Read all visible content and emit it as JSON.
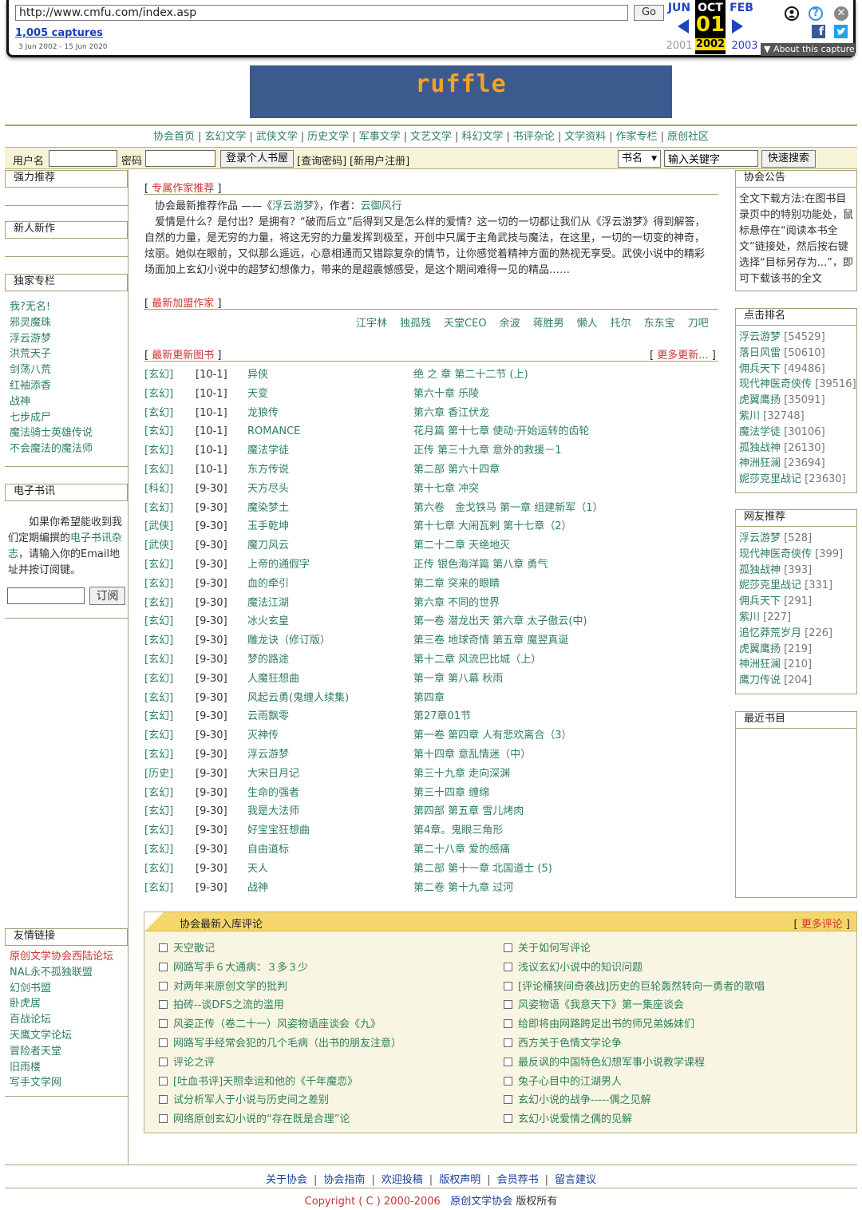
{
  "wayback": {
    "url": "http://www.cmfu.com/index.asp",
    "go_label": "Go",
    "captures": "1,005 captures",
    "range": "3 Jun 2002 - 15 Jun 2020",
    "prev_month": "JUN",
    "cur_month": "OCT",
    "next_month": "FEB",
    "cur_day": "01",
    "prev_year": "2001",
    "cur_year": "2002",
    "next_year": "2003",
    "about": "About this capture"
  },
  "banner": {
    "text": "ruffle"
  },
  "nav": [
    "协会首页",
    "玄幻文学",
    "武侠文学",
    "历史文学",
    "军事文学",
    "文艺文学",
    "科幻文学",
    "书评杂论",
    "文学资料",
    "作家专栏",
    "原创社区"
  ],
  "login": {
    "user_label": "用户名",
    "pass_label": "密码",
    "login_button": "登录个人书屋",
    "query_pass": "[查询密码]",
    "register": "[新用户注册]",
    "search_select": "书名",
    "search_placeholder": "输入关键字",
    "search_button": "快速搜索"
  },
  "left": {
    "strong_title": "强力推荐",
    "new_title": "新人新作",
    "exclusive_title": "独家专栏",
    "exclusive_items": [
      "我?无名!",
      "邪灵魔珠",
      "浮云游梦",
      "洪荒天子",
      "剑荡八荒",
      "红袖添香",
      "战神",
      "七步成尸",
      "魔法骑士英雄传说",
      "不会魔法的魔法师"
    ],
    "ebook_title": "电子书讯",
    "ebook_text_1": "如果你希望能收到我们定期编撰的",
    "ebook_link": "电子书讯杂志",
    "ebook_text_2": "，请输入你的Email地址并按订阅键。",
    "subscribe_button": "订阅",
    "friends_title": "友情链接",
    "friends": [
      "原创文学协会西陆论坛",
      "NAL永不孤独联盟",
      "幻剑书盟",
      "卧虎居",
      "百战论坛",
      "天鹰文学论坛",
      "冒险者天堂",
      "旧雨楼",
      "写手文学网"
    ]
  },
  "main": {
    "feature_title": "专属作家推荐",
    "feature_intro_1": "协会最新推荐作品 ——《",
    "feature_book": "浮云游梦",
    "feature_intro_2": "》，作者：",
    "feature_author": "云御风行",
    "feature_body": "爱情是什么？是付出？是拥有？“破而后立”后得到又是怎么样的爱情？这一切的一切都让我们从《浮云游梦》得到解答，自然的力量，是无穷的力量，将这无穷的力量发挥到极至，开创中只属于主角武技与魔法，在这里，一切的一切变的神奇，炫丽。她似在眼前，又似那么遥远，心意相通而又错踪复杂的情节，让你感觉着精神方面的熟视无享受。武侠小说中的精彩场面加上玄幻小说中的超梦幻想像力，带来的是超震憾感受，是这个期间难得一见的精品……",
    "new_authors_title": "最新加盟作家",
    "new_authors": [
      "江宇林",
      "独孤残",
      "天堂CEO",
      "余波",
      "蒋胜男",
      "懒人",
      "托尔",
      "东东宝",
      "刀吧",
      "冰"
    ],
    "updates_title": "最新更新图书",
    "more_updates": "更多更新...",
    "books": [
      {
        "cat": "[玄幻]",
        "date": "[10-1]",
        "name": "异侠",
        "chapter": "绝 之 章 第二十二节 (上)"
      },
      {
        "cat": "[玄幻]",
        "date": "[10-1]",
        "name": "天变",
        "chapter": "第六十章 乐陵"
      },
      {
        "cat": "[玄幻]",
        "date": "[10-1]",
        "name": "龙狼传",
        "chapter": "第六章 香江伏龙"
      },
      {
        "cat": "[玄幻]",
        "date": "[10-1]",
        "name": "ROMANCE",
        "chapter": "花月篇 第十七章 使动·开始运转的齿轮"
      },
      {
        "cat": "[玄幻]",
        "date": "[10-1]",
        "name": "魔法学徒",
        "chapter": "正传 第三十九章 意外的救援－1"
      },
      {
        "cat": "[玄幻]",
        "date": "[10-1]",
        "name": "东方传说",
        "chapter": "第二部 第六十四章"
      },
      {
        "cat": "[科幻]",
        "date": "[9-30]",
        "name": "天方尽头",
        "chapter": "第十七章 冲突"
      },
      {
        "cat": "[玄幻]",
        "date": "[9-30]",
        "name": "魔染梦土",
        "chapter": "第六卷　金戈铁马 第一章 组建新军（1）"
      },
      {
        "cat": "[武侠]",
        "date": "[9-30]",
        "name": "玉手乾坤",
        "chapter": "第十七章 大闹瓦剌 第十七章（2）"
      },
      {
        "cat": "[武侠]",
        "date": "[9-30]",
        "name": "魔刀风云",
        "chapter": "第二十二章 天绝地灭"
      },
      {
        "cat": "[玄幻]",
        "date": "[9-30]",
        "name": "上帝的通假字",
        "chapter": "正传 银色海洋篇 第八章 勇气"
      },
      {
        "cat": "[玄幻]",
        "date": "[9-30]",
        "name": "血的牵引",
        "chapter": "第二章 突来的眼睛"
      },
      {
        "cat": "[玄幻]",
        "date": "[9-30]",
        "name": "魔法江湖",
        "chapter": "第六章 不同的世界"
      },
      {
        "cat": "[玄幻]",
        "date": "[9-30]",
        "name": "冰火玄皇",
        "chapter": "第一卷 潜龙出天 第六章 太子傲云(中)"
      },
      {
        "cat": "[玄幻]",
        "date": "[9-30]",
        "name": "雕龙诀（修订版）",
        "chapter": "第三卷 地球奇情 第五章 魔翌真诞"
      },
      {
        "cat": "[玄幻]",
        "date": "[9-30]",
        "name": "梦的路途",
        "chapter": "第十二章 风流巴比城（上）"
      },
      {
        "cat": "[玄幻]",
        "date": "[9-30]",
        "name": "人魔狂想曲",
        "chapter": "第一章 第八幕 秋雨"
      },
      {
        "cat": "[玄幻]",
        "date": "[9-30]",
        "name": "风起云勇(鬼缠人续集)",
        "chapter": "第四章"
      },
      {
        "cat": "[玄幻]",
        "date": "[9-30]",
        "name": "云雨飘零",
        "chapter": "第27章01节"
      },
      {
        "cat": "[玄幻]",
        "date": "[9-30]",
        "name": "灭神传",
        "chapter": "第一卷 第四章 人有悲欢离合（3）"
      },
      {
        "cat": "[玄幻]",
        "date": "[9-30]",
        "name": "浮云游梦",
        "chapter": "第十四章 意乱情迷（中）"
      },
      {
        "cat": "[历史]",
        "date": "[9-30]",
        "name": "大宋日月记",
        "chapter": "第三十九章 走向深渊"
      },
      {
        "cat": "[玄幻]",
        "date": "[9-30]",
        "name": "生命的强者",
        "chapter": "第三十四章 缠绵"
      },
      {
        "cat": "[玄幻]",
        "date": "[9-30]",
        "name": "我是大法师",
        "chapter": "第四部 第五章 雪儿烤肉"
      },
      {
        "cat": "[玄幻]",
        "date": "[9-30]",
        "name": "好宝宝狂想曲",
        "chapter": "第4章。鬼眼三角形"
      },
      {
        "cat": "[玄幻]",
        "date": "[9-30]",
        "name": "自由道标",
        "chapter": "第二十八章 爱的感痛"
      },
      {
        "cat": "[玄幻]",
        "date": "[9-30]",
        "name": "天人",
        "chapter": "第二部 第十一章 北国道士 (5)"
      },
      {
        "cat": "[玄幻]",
        "date": "[9-30]",
        "name": "战神",
        "chapter": "第二卷 第十九章 过河"
      }
    ],
    "comments_title": "协会最新入库评论",
    "more_comments": "更多评论",
    "comments_left": [
      "天空散记",
      "网路写手６大通病：３多３少",
      "对两年来原创文学的批判",
      "拍砖--谈DFS之流的滥用",
      "风姿正传（卷二十一）风姿物语座谈会《九》",
      "网路写手经常会犯的几个毛病（出书的朋友注意）",
      "评论之评",
      "[吐血书评]天照幸运和他的《千年魔恋》",
      "试分析军人于小说与历史间之差别",
      "网络原创玄幻小说的“存在既是合理”论"
    ],
    "comments_right": [
      "关于如何写评论",
      "浅议玄幻小说中的知识问题",
      "[评论桶狭间奇袭战]历史的巨轮轰然转向一勇者的歌唱",
      "风姿物语《我意天下》第一集座谈会",
      "给即将由网路跨足出书的师兄弟姊妹们",
      "西方关于色情文学论争",
      "最反讽的中国特色幻想军事小说教学课程",
      "兔子心目中的江湖男人",
      "玄幻小说的战争-----偶之见解",
      "玄幻小说爱情之偶的见解"
    ]
  },
  "right": {
    "notice_title": "协会公告",
    "notice_text": "全文下载方法:在图书目录页中的特别功能处，鼠标悬停在“阅读本书全文”链接处，然后按右键选择“目标另存为...”，即可下载该书的全文",
    "rank_title": "点击排名",
    "rank": [
      {
        "name": "浮云游梦",
        "count": "[54529]"
      },
      {
        "name": "落日风雷",
        "count": "[50610]"
      },
      {
        "name": "佣兵天下",
        "count": "[49486]"
      },
      {
        "name": "现代神医奇侠传",
        "count": "[39516]"
      },
      {
        "name": "虎翼鹰扬",
        "count": "[35091]"
      },
      {
        "name": "紫川",
        "count": "[32748]"
      },
      {
        "name": "魔法学徒",
        "count": "[30106]"
      },
      {
        "name": "孤独战神",
        "count": "[26130]"
      },
      {
        "name": "神洲狂澜",
        "count": "[23694]"
      },
      {
        "name": "妮莎克里战记",
        "count": "[23630]"
      }
    ],
    "fans_title": "网友推荐",
    "fans": [
      {
        "name": "浮云游梦",
        "count": "[528]"
      },
      {
        "name": "现代神医奇侠传",
        "count": "[399]"
      },
      {
        "name": "孤独战神",
        "count": "[393]"
      },
      {
        "name": "妮莎克里战记",
        "count": "[331]"
      },
      {
        "name": "佣兵天下",
        "count": "[291]"
      },
      {
        "name": "紫川",
        "count": "[227]"
      },
      {
        "name": "追忆莽荒岁月",
        "count": "[226]"
      },
      {
        "name": "虎翼鹰扬",
        "count": "[219]"
      },
      {
        "name": "神洲狂澜",
        "count": "[210]"
      },
      {
        "name": "鹰刀传说",
        "count": "[204]"
      }
    ],
    "recent_title": "最近书目"
  },
  "footer": {
    "links": [
      "关于协会",
      "协会指南",
      "欢迎投稿",
      "版权声明",
      "会员荐书",
      "留言建议"
    ],
    "copyright": "Copyright ( C ) 2000-2006",
    "org": "原创文学协会",
    "rights": "版权所有"
  },
  "colors": {
    "link": "#2f7f5f",
    "accent_red": "#cc3333",
    "border": "#a9a27c",
    "comment_header": "#f6d66b"
  }
}
